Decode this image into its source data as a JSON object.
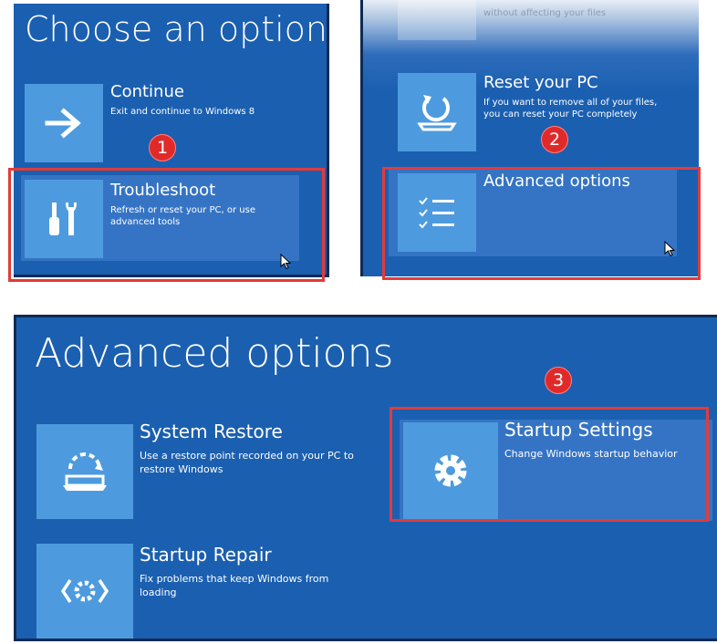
{
  "panel1": {
    "title": "Choose an option",
    "continue": {
      "title": "Continue",
      "desc": "Exit and continue to Windows 8"
    },
    "troubleshoot": {
      "title": "Troubleshoot",
      "desc": "Refresh or reset your PC, or use advanced tools"
    },
    "step": "1"
  },
  "panel2": {
    "partial_desc": "without affecting your files",
    "reset": {
      "title": "Reset your PC",
      "desc": "If you want to remove all of your files, you can reset your PC completely"
    },
    "advanced": {
      "title": "Advanced options"
    },
    "step": "2"
  },
  "panel3": {
    "title": "Advanced options",
    "system_restore": {
      "title": "System Restore",
      "desc": "Use a restore point recorded on your PC to restore Windows"
    },
    "startup_repair": {
      "title": "Startup Repair",
      "desc": "Fix problems that keep Windows from loading"
    },
    "startup_settings": {
      "title": "Startup Settings",
      "desc": "Change Windows startup behavior"
    },
    "step": "3"
  },
  "colors": {
    "background": "#1b5fb0",
    "tile": "#4d9bde",
    "highlight": "#e23b3b",
    "badge": "#e02a2a"
  },
  "icons": [
    "arrow-right-icon",
    "tools-icon",
    "refresh-pc-icon",
    "checklist-icon",
    "restore-icon",
    "startup-repair-icon",
    "gear-icon",
    "mouse-cursor-icon"
  ]
}
